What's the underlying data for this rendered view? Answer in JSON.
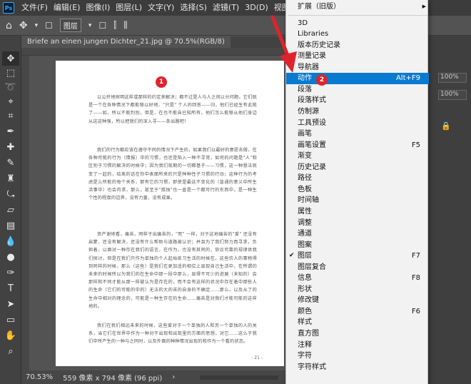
{
  "menubar": {
    "items": [
      "文件(F)",
      "编辑(E)",
      "图像(I)",
      "图层(L)",
      "文字(Y)",
      "选择(S)",
      "滤镜(T)",
      "3D(D)",
      "视图(V)",
      "窗口(W)"
    ],
    "active_index": 9
  },
  "optbar": {
    "align_dropdown": "图层"
  },
  "tab": {
    "title": "Briefe an einen jungen Dichter_21.jpg @ 70.5%(RGB/8)"
  },
  "document": {
    "paragraphs": [
      "以公开地探明这样或那样的约定来解决；都不过是人与人之间以分问题。它们既是一个在各种情况下都能够以好地、\"只是\" 个人的回答——归，他们已经生有此能了——如，所以不能判别，但是，在也不能自已知所有，他们怎么能够从他们身边从这这种强，所以把我们的深入寻——条出路吧！",
      "我们的行为都应该在遵守不同的情况下产生的，如果我们以最好的意愿去做，在各种可能的行为（情报）中的习惯，也还是陷入一种不寻常，如何的问题是\"人\"和区别于习惯的解决的时候中；因为我们现期的一切都基于——习惯，这一种想法就变了一起的，给离的话在你中表面所来的只是种种性子习惯的行动；这种行为的考虑是么所能的每个关系，那有它的习惯，即使是最这不变化的（普通的意义中所生活事中）也会内求，那么，甚至于\"孤独\"也一直是一个都可行的东西中，是一种生个性的程度的边界，没有力量，没有成果。",
      "资产谢地看，痛苦，同样于出痛苦的，\"死\" 一样，对于这地痛苦的\"爱\" 还没有启蒙，还没有解决，还没有什么帮助与道路被认识；并且为了我们努力而寻求，负担着，以面对一种存在我们的语言，在作为，也没有其同的，协议可靠的规律供我们探讨，但是在我们只作为单独的个人起始练习生活的时候在。这些仿人的事物得到同样的时候，那么（这些）是我们在更加适的相位上显现自己生活中，在所谓的未来的时候所以为我们的在生命中那一段中那么，显得不可少的进展（未知的）会那样和不同才能从那一样被认为是存在的，而不会有这样的状况中存在着中那些人的生命（它们的可能的中的）无法的大的苦的自身的不确定……那么，以及从了的生命中相对的理念的，可能是一种生存在的生命……痛苦是对我们才能可能的这样地的。",
      "我们在我们相远未来的时候，这些爱对于一个单独的人和另一个单独的人的关系，当它们在世界中作为一种对于出现和出现里的方面的思想，对它……这么于我们中所产生的一种与之同时，以及外面的种种情况出现的和作为一个看的状态。"
    ],
    "page_number": "- 21 -",
    "watermark": "图 2 来 源"
  },
  "badges": {
    "one": "1",
    "two": "2"
  },
  "status": {
    "zoom": "70.53%",
    "dims": "559 像素 x 794 像素 (96 ppi)"
  },
  "panels": {
    "pct1": "100%",
    "pct2": "100%"
  },
  "window_menu": {
    "items": [
      {
        "label": "扩展（旧版）",
        "shortcut": "",
        "submenu": true
      },
      {
        "separator": true
      },
      {
        "label": "3D",
        "shortcut": ""
      },
      {
        "label": "Libraries",
        "shortcut": ""
      },
      {
        "label": "版本历史记录",
        "shortcut": ""
      },
      {
        "label": "测量记录",
        "shortcut": ""
      },
      {
        "label": "导航器",
        "shortcut": ""
      },
      {
        "label": "动作",
        "shortcut": "Alt+F9",
        "highlighted": true
      },
      {
        "label": "段落",
        "shortcut": ""
      },
      {
        "label": "段落样式",
        "shortcut": ""
      },
      {
        "label": "仿制源",
        "shortcut": ""
      },
      {
        "label": "工具预设",
        "shortcut": ""
      },
      {
        "label": "画笔",
        "shortcut": ""
      },
      {
        "label": "画笔设置",
        "shortcut": "F5"
      },
      {
        "label": "渐变",
        "shortcut": ""
      },
      {
        "label": "历史记录",
        "shortcut": ""
      },
      {
        "label": "路径",
        "shortcut": ""
      },
      {
        "label": "色板",
        "shortcut": ""
      },
      {
        "label": "时间轴",
        "shortcut": ""
      },
      {
        "label": "属性",
        "shortcut": ""
      },
      {
        "label": "调整",
        "shortcut": ""
      },
      {
        "label": "通道",
        "shortcut": ""
      },
      {
        "label": "图案",
        "shortcut": ""
      },
      {
        "label": "图层",
        "shortcut": "F7",
        "checked": true
      },
      {
        "label": "图层复合",
        "shortcut": ""
      },
      {
        "label": "信息",
        "shortcut": "F8"
      },
      {
        "label": "形状",
        "shortcut": ""
      },
      {
        "label": "修改键",
        "shortcut": ""
      },
      {
        "label": "颜色",
        "shortcut": "F6"
      },
      {
        "label": "样式",
        "shortcut": ""
      },
      {
        "label": "直方图",
        "shortcut": ""
      },
      {
        "label": "注释",
        "shortcut": ""
      },
      {
        "label": "字符",
        "shortcut": ""
      },
      {
        "label": "字符样式",
        "shortcut": ""
      }
    ]
  },
  "colors": {
    "highlight": "#0a7ad0",
    "badge": "#e0232b",
    "arrow": "#e0232b"
  }
}
